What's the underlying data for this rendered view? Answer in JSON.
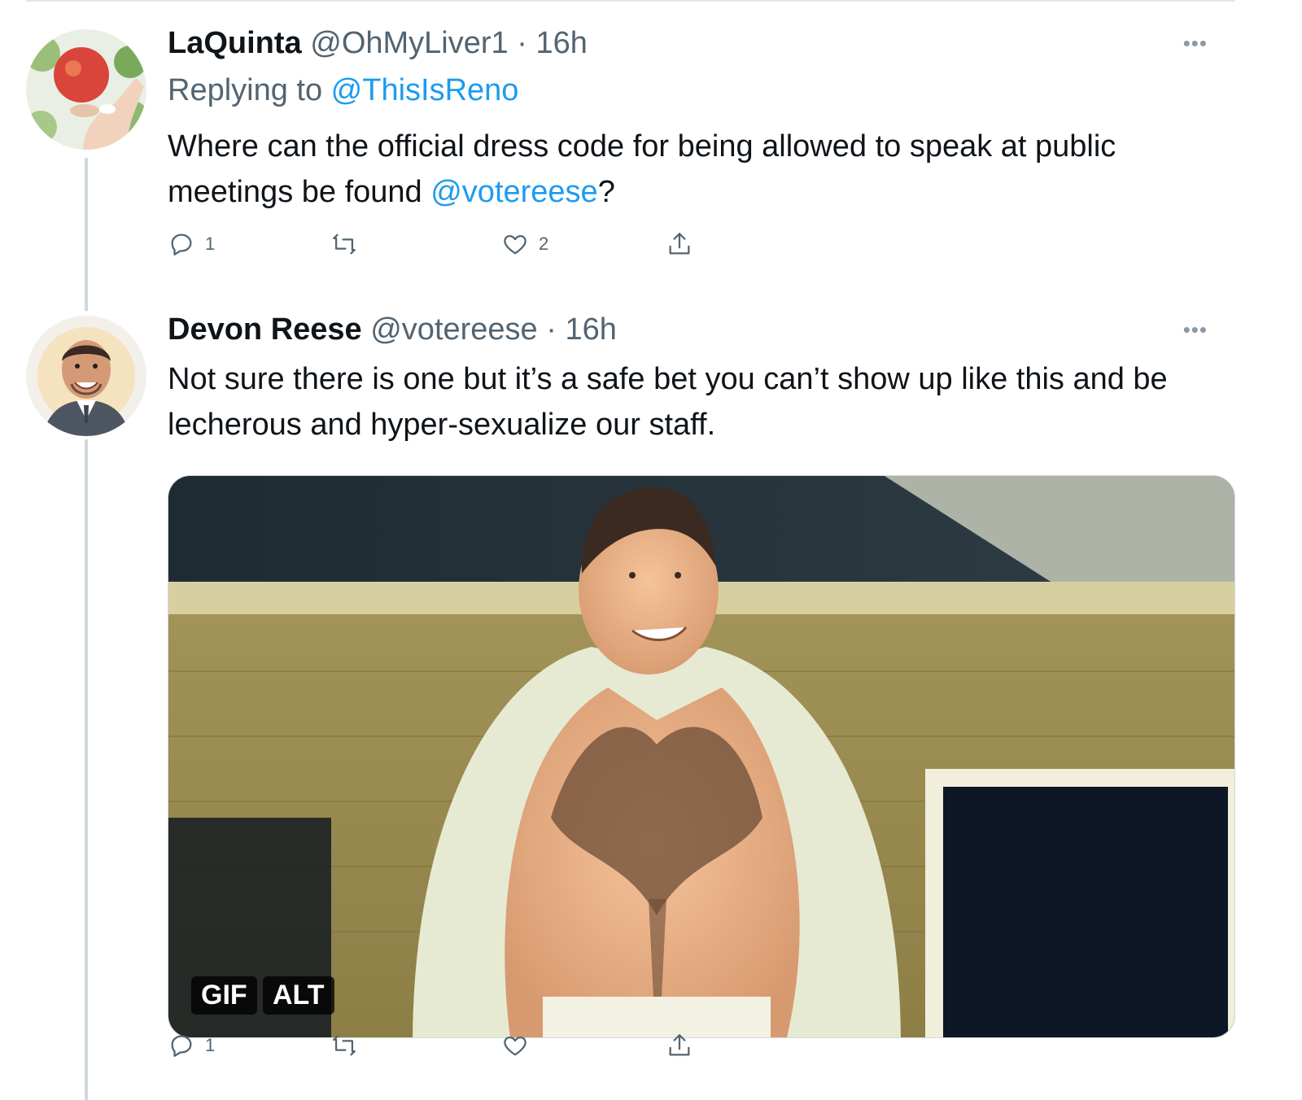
{
  "tweets": [
    {
      "display_name": "LaQuinta",
      "handle": "@OhMyLiver1",
      "separator": "·",
      "time": "16h",
      "replying_prefix": "Replying to ",
      "replying_handle": "@ThisIsReno",
      "text_before_mention": "Where can the official dress code for being allowed to speak at public meetings be found ",
      "mention": "@votereese",
      "text_after_mention": "?",
      "reply_count": "1",
      "retweet_count": "",
      "like_count": "2"
    },
    {
      "display_name": "Devon Reese",
      "handle": "@votereese",
      "separator": "·",
      "time": "16h",
      "text": "Not sure there is one but it’s a safe bet you can’t show up like this and be lecherous and hyper-sexualize our staff.",
      "media": {
        "gif_label": "GIF",
        "alt_label": "ALT"
      },
      "reply_count": "1",
      "retweet_count": "",
      "like_count": ""
    }
  ],
  "icons": {
    "reply": "reply-icon",
    "retweet": "retweet-icon",
    "like": "heart-icon",
    "share": "share-icon",
    "more": "more-icon"
  },
  "colors": {
    "link": "#1d9bf0",
    "secondary_text": "#536471",
    "primary_text": "#0f1419",
    "thread_line": "#cfd9de"
  }
}
